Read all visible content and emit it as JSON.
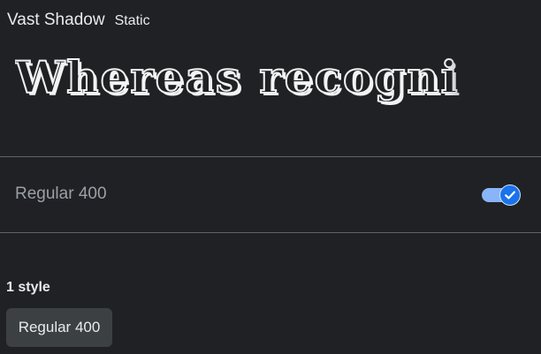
{
  "header": {
    "font_name": "Vast Shadow",
    "font_type": "Static"
  },
  "preview": {
    "text": "Whereas recogni"
  },
  "style_row": {
    "label": "Regular 400",
    "toggle_on": true,
    "toggle_icon": "check-icon"
  },
  "styles_section": {
    "count_label": "1 style",
    "chips": [
      {
        "label": "Regular 400"
      }
    ]
  },
  "colors": {
    "background": "#202124",
    "text": "#e8eaed",
    "muted_text": "#9aa0a6",
    "divider": "#5f6368",
    "accent": "#1a73e8",
    "accent_light": "#8ab4f8",
    "chip_bg": "#3c4043"
  }
}
